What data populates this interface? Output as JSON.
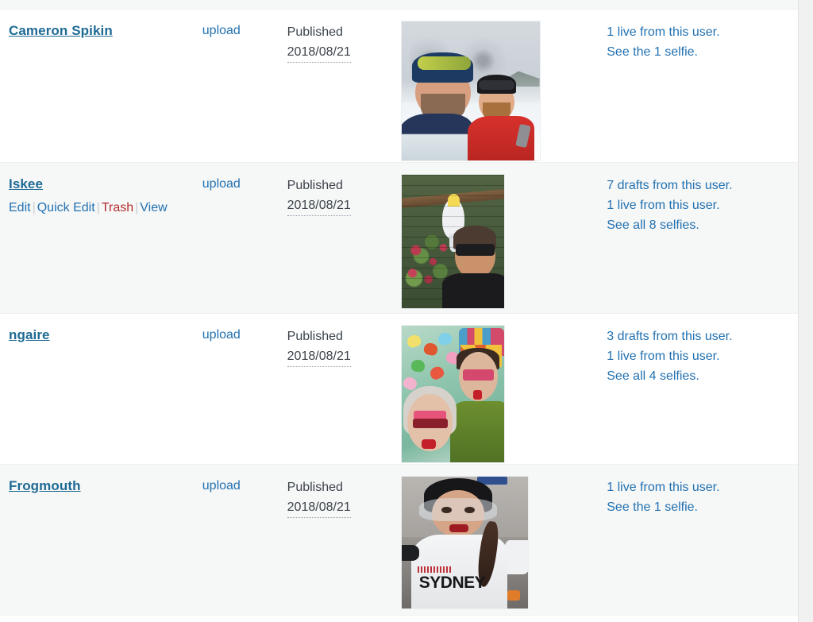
{
  "theme": {
    "link_color": "#2271b1",
    "author_link_color": "#1e6a94",
    "trash_color": "#b32d2e",
    "text_color": "#3c434a",
    "row_alt_background": "#f6f7f7",
    "row_background": "#ffffff",
    "page_background": "#f1f1f1"
  },
  "table": {
    "separator": "|",
    "rows": [
      {
        "author": "Cameron Spikin",
        "actions": [],
        "type": "upload",
        "status": "Published",
        "date": "2018/08/21",
        "thumbnail_alt": "snow-selfie-two-men",
        "info": [
          "1 live from this user.",
          "See the 1 selfie."
        ]
      },
      {
        "author": "Iskee",
        "actions": [
          {
            "label": "Edit",
            "kind": "edit"
          },
          {
            "label": "Quick Edit",
            "kind": "quick-edit"
          },
          {
            "label": "Trash",
            "kind": "trash"
          },
          {
            "label": "View",
            "kind": "view"
          }
        ],
        "type": "upload",
        "status": "Published",
        "date": "2018/08/21",
        "thumbnail_alt": "cockatoo-mural-selfie",
        "info": [
          "7 drafts from this user.",
          "1 live from this user.",
          "See all 8 selfies."
        ]
      },
      {
        "author": "ngaire",
        "actions": [],
        "type": "upload",
        "status": "Published",
        "date": "2018/08/21",
        "thumbnail_alt": "butterfly-facepaint-duo-selfie",
        "info": [
          "3 drafts from this user.",
          "1 live from this user.",
          "See all 4 selfies."
        ]
      },
      {
        "author": "Frogmouth",
        "actions": [],
        "type": "upload",
        "status": "Published",
        "date": "2018/08/21",
        "thumbnail_alt": "cyclist-sydney-jersey-selfie",
        "info": [
          "1 live from this user.",
          "See the 1 selfie."
        ]
      }
    ]
  },
  "thumb_text": {
    "sydney": "SYDNEY"
  }
}
